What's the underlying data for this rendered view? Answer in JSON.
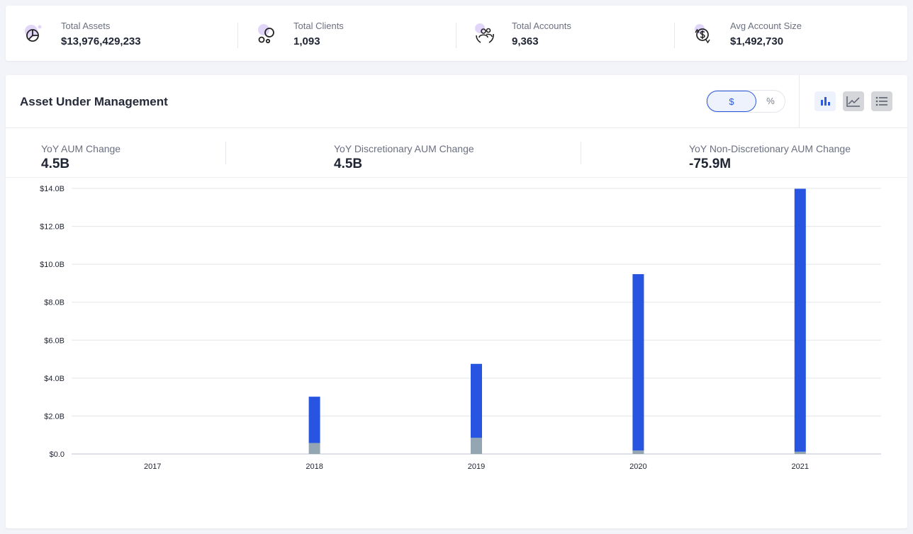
{
  "stats": [
    {
      "label": "Total Assets",
      "value": "$13,976,429,233",
      "icon": "pie-chart-icon"
    },
    {
      "label": "Total Clients",
      "value": "1,093",
      "icon": "clients-icon"
    },
    {
      "label": "Total Accounts",
      "value": "9,363",
      "icon": "accounts-icon"
    },
    {
      "label": "Avg Account Size",
      "value": "$1,492,730",
      "icon": "dollar-cycle-icon"
    }
  ],
  "aum": {
    "title": "Asset Under Management",
    "toggle": {
      "dollar": "$",
      "percent": "%",
      "selected": "$"
    },
    "views": [
      "bar-chart-icon",
      "line-chart-icon",
      "list-icon"
    ],
    "selected_view": "bar-chart-icon",
    "metrics": [
      {
        "label": "YoY AUM Change",
        "value": "4.5B"
      },
      {
        "label": "YoY Discretionary AUM Change",
        "value": "4.5B"
      },
      {
        "label": "YoY Non-Discretionary AUM Change",
        "value": "-75.9M"
      }
    ]
  },
  "colors": {
    "accent": "#2e5bde",
    "discretionary": "#2754e0",
    "non_discretionary": "#93a6b2",
    "gridline": "#e3e5ea"
  },
  "chart_data": {
    "type": "bar",
    "stacked": true,
    "categories": [
      "2017",
      "2018",
      "2019",
      "2020",
      "2021"
    ],
    "series": [
      {
        "values": [
          0,
          0.58,
          0.85,
          0.18,
          0.12
        ]
      },
      {
        "values": [
          0,
          2.44,
          3.9,
          9.3,
          13.86
        ]
      }
    ],
    "ylim": [
      0,
      14
    ],
    "yticks": [
      {
        "value": 0,
        "label": "$0.0"
      },
      {
        "value": 2,
        "label": "$2.0B"
      },
      {
        "value": 4,
        "label": "$4.0B"
      },
      {
        "value": 6,
        "label": "$6.0B"
      },
      {
        "value": 8,
        "label": "$8.0B"
      },
      {
        "value": 10,
        "label": "$10.0B"
      },
      {
        "value": 12,
        "label": "$12.0B"
      },
      {
        "value": 14,
        "label": "$14.0B"
      }
    ],
    "grid": true,
    "legend": "none"
  }
}
